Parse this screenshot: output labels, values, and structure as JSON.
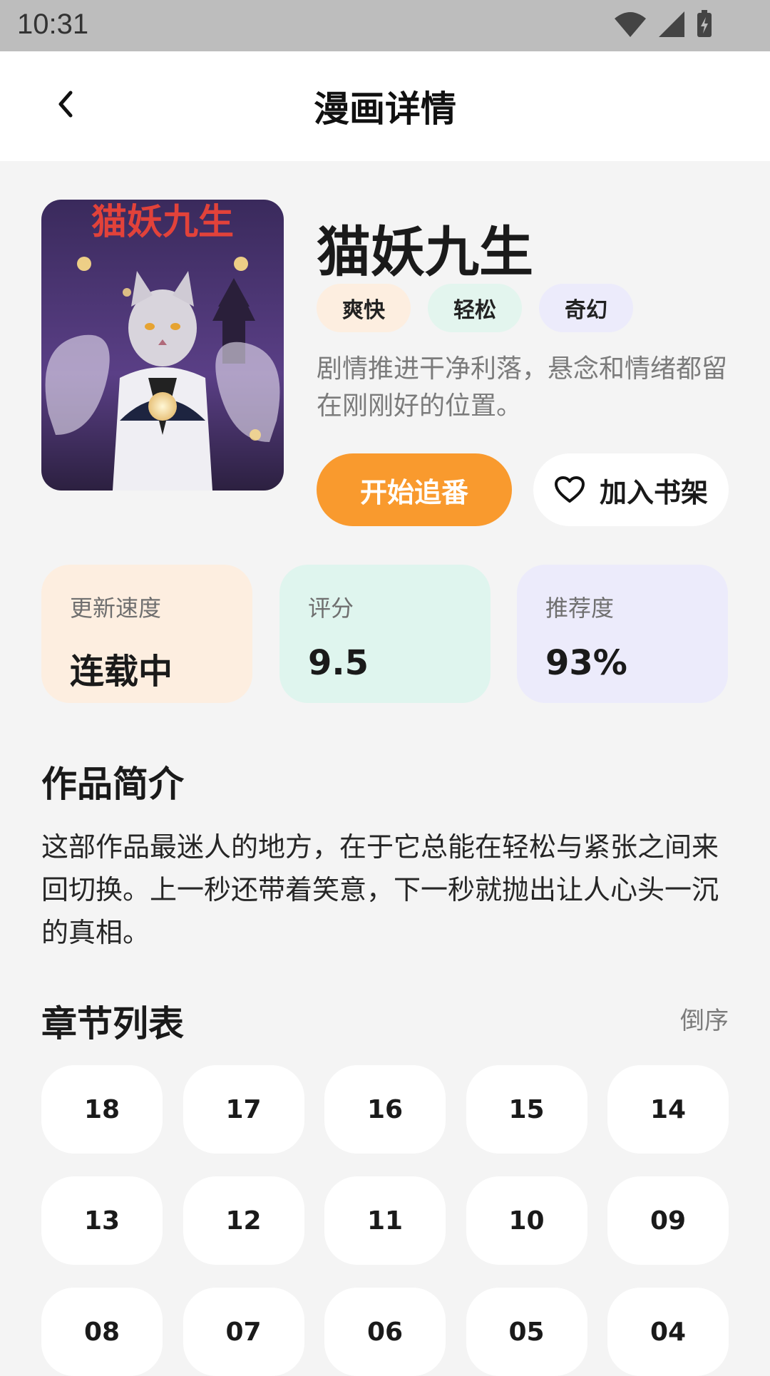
{
  "status_bar": {
    "time": "10:31",
    "icons": [
      "wifi-icon",
      "signal-icon",
      "battery-charging-icon"
    ]
  },
  "header": {
    "title": "漫画详情",
    "back_icon": "chevron-left-icon"
  },
  "comic": {
    "cover_title": "猫妖九生",
    "title": "猫妖九生",
    "tags": [
      "爽快",
      "轻松",
      "奇幻"
    ],
    "tagline": "剧情推进干净利落，悬念和情绪都留在刚刚好的位置。"
  },
  "actions": {
    "start_label": "开始追番",
    "shelf_label": "加入书架",
    "shelf_icon": "heart-outline-icon"
  },
  "stats": [
    {
      "label": "更新速度",
      "value": "连载中"
    },
    {
      "label": "评分",
      "value": "9.5"
    },
    {
      "label": "推荐度",
      "value": "93%"
    }
  ],
  "intro": {
    "title": "作品简介",
    "text": "这部作品最迷人的地方，在于它总能在轻松与紧张之间来回切换。上一秒还带着笑意，下一秒就抛出让人心头一沉的真相。"
  },
  "chapters": {
    "title": "章节列表",
    "sort_label": "倒序",
    "items": [
      "18",
      "17",
      "16",
      "15",
      "14",
      "13",
      "12",
      "11",
      "10",
      "09",
      "08",
      "07",
      "06",
      "05",
      "04"
    ]
  },
  "colors": {
    "accent": "#f99a2e",
    "background": "#f4f4f4"
  }
}
